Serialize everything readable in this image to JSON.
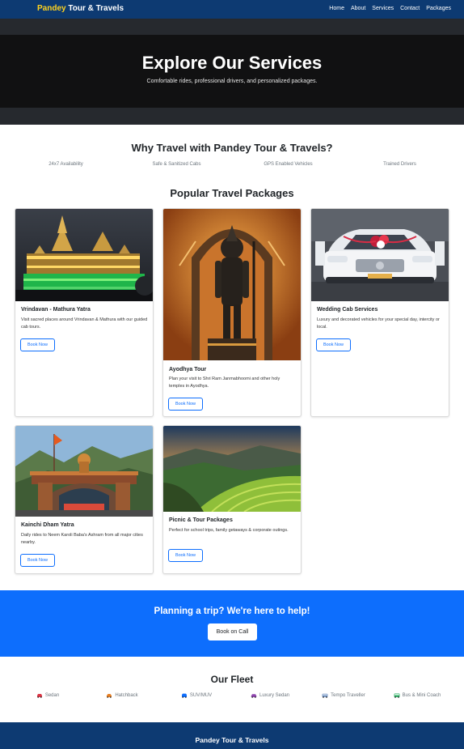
{
  "navbar": {
    "brand_accent": "Pandey",
    "brand_rest": " Tour & Travels",
    "links": [
      "Home",
      "About",
      "Services",
      "Contact",
      "Packages"
    ]
  },
  "hero": {
    "title": "Explore Our Services",
    "subtitle": "Comfortable rides, professional drivers, and personalized packages."
  },
  "why": {
    "title": "Why Travel with Pandey Tour & Travels?",
    "features": [
      "24x7 Availability",
      "Safe & Sanitized Cabs",
      "GPS Enabled Vehicles",
      "Trained Drivers"
    ]
  },
  "packages": {
    "title": "Popular Travel Packages",
    "items": [
      {
        "title": "Vrindavan - Mathura Yatra",
        "text": "Visit sacred places around Vrindavan & Mathura with our guided cab tours.",
        "button": "Book Now"
      },
      {
        "title": "Ayodhya Tour",
        "text": "Plan your visit to Shri Ram Janmabhoomi and other holy temples in Ayodhya.",
        "button": "Book Now"
      },
      {
        "title": "Wedding Cab Services",
        "text": "Luxury and decorated vehicles for your special day, intercity or local.",
        "button": "Book Now"
      },
      {
        "title": "Kainchi Dham Yatra",
        "text": "Daily rides to Neem Karoli Baba's Ashram from all major cities nearby.",
        "button": "Book Now"
      },
      {
        "title": "Picnic & Tour Packages",
        "text": "Perfect for school trips, family getaways & corporate outings.",
        "button": "Book Now"
      }
    ]
  },
  "cta": {
    "title": "Planning a trip? We're here to help!",
    "button": "Book on Call"
  },
  "fleet": {
    "title": "Our Fleet",
    "items": [
      "Sedan",
      "Hatchback",
      "SUV/MUV",
      "Luxury Sedan",
      "Tempo Traveller",
      "Bus & Mini Coach"
    ]
  },
  "footer": {
    "brand": "Pandey Tour & Travels"
  },
  "colors": {
    "navbar": "#0d3a72",
    "brand_accent": "#ffd21f",
    "primary": "#0d6efd",
    "hero": "#111112"
  },
  "icons": [
    "car-icon",
    "hatchback-icon",
    "suv-icon",
    "luxury-sedan-icon",
    "tempo-traveller-icon",
    "bus-icon"
  ]
}
